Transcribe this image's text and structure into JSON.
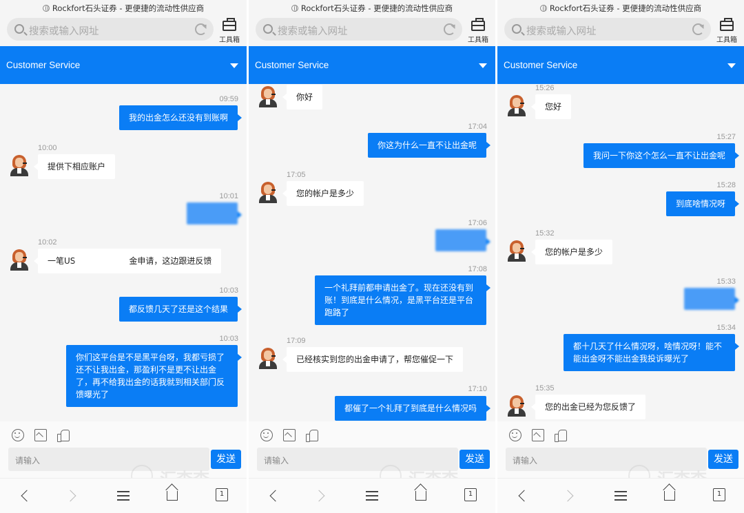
{
  "shared": {
    "site_title": "Rockfort石头证券 - 更便捷的流动性供应商",
    "search_placeholder": "搜索或输入网址",
    "toolbox_label": "工具箱",
    "header_title": "Customer Service",
    "input_placeholder": "请输入",
    "send_label": "发送",
    "tabs_count": "1",
    "watermark": "汇查查",
    "accent_color": "#0a7df5"
  },
  "panels": [
    {
      "messages": [
        {
          "time": "09:59",
          "side": "out",
          "text": "我的出金怎么还没有到账啊"
        },
        {
          "time": "10:00",
          "side": "in",
          "text": "提供下相应账户"
        },
        {
          "time": "10:01",
          "side": "out",
          "text": "",
          "redacted": true
        },
        {
          "time": "10:02",
          "side": "in",
          "text_a": "一笔US",
          "text_b": "金申请，这边跟进反馈"
        },
        {
          "time": "10:03",
          "side": "out",
          "text": "都反馈几天了还是这个结果"
        },
        {
          "time": "10:03",
          "side": "out",
          "lines": [
            "你们这平台是不是黑平台呀，我都亏损了",
            "还不让我出金，那盈利不是更不让出金",
            "了，再不给我出金的话我就到相关部门反",
            "馈曝光了"
          ]
        }
      ]
    },
    {
      "messages": [
        {
          "side": "in",
          "text": "你好"
        },
        {
          "time": "17:04",
          "side": "out",
          "text": "你这为什么一直不让出金呢"
        },
        {
          "time": "17:05",
          "side": "in",
          "text": "您的帐户是多少"
        },
        {
          "time": "17:06",
          "side": "out",
          "text": "",
          "redacted": true
        },
        {
          "time": "17:08",
          "side": "out",
          "lines": [
            "一个礼拜前都申请出金了。现在还没有到",
            "账！到底是什么情况，是黑平台还是平台",
            "跑路了"
          ]
        },
        {
          "time": "17:09",
          "side": "in",
          "text": "已经核实到您的出金申请了，帮您催促一下"
        },
        {
          "time": "17:10",
          "side": "out",
          "text": "都催了一个礼拜了到底是什么情况吗"
        }
      ]
    },
    {
      "messages": [
        {
          "time": "15:26",
          "side": "in",
          "text": "您好"
        },
        {
          "time": "15:27",
          "side": "out",
          "text": "我问一下你这个怎么一直不让出金呢"
        },
        {
          "time": "15:28",
          "side": "out",
          "text": "到底啥情况呀"
        },
        {
          "time": "15:32",
          "side": "in",
          "text": "您的帐户是多少"
        },
        {
          "time": "15:33",
          "side": "out",
          "text": "",
          "redacted": true
        },
        {
          "time": "15:34",
          "side": "out",
          "lines": [
            "都十几天了什么情况呀，啥情况呀！能不",
            "能出金呀不能出金我投诉曝光了"
          ]
        },
        {
          "time": "15:35",
          "side": "in",
          "text": "您的出金已经为您反馈了"
        }
      ]
    }
  ]
}
